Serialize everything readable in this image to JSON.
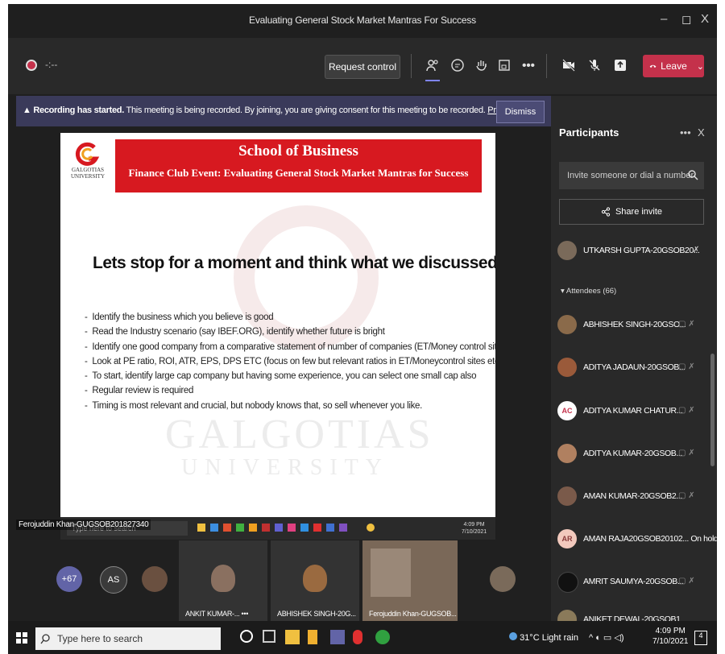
{
  "window": {
    "title": "Evaluating General Stock Market Mantras For Success",
    "minimize": "–",
    "maximize": "◻",
    "close": "X"
  },
  "toolbar": {
    "timer": "-:--",
    "request_control": "Request control",
    "more": "•••",
    "leave": "Leave",
    "leave_chevron": "⌄"
  },
  "banner": {
    "bold": "Recording has started.",
    "text": " This meeting is being recorded. By joining, you are giving consent for this meeting to be recorded. ",
    "link": "Privacy policy",
    "dismiss": "Dismiss"
  },
  "slide": {
    "school": "School of Business",
    "event": "Finance Club Event: Evaluating General Stock Market Mantras for Success",
    "logo_text": "GALGOTIAS UNIVERSITY",
    "heading": "Lets stop for a moment and think what we discussed till now……",
    "bullets": [
      "Identify the business which you believe is good",
      "Read the Industry scenario (say IBEF.ORG), identify whether future is bright",
      "Identify one good company from a comparative statement of number of companies (ET/Money control sites etc )",
      "Look at PE ratio, ROI, ATR, EPS, DPS ETC (focus on few but relevant ratios in ET/Moneycontrol sites etc)",
      "To start, identify large cap company but having some experience, you can select one small cap also",
      "Regular review is required",
      "Timing is most relevant and crucial, but nobody knows that, so sell whenever you like."
    ],
    "watermark1": "GALGOTIAS",
    "watermark2": "UNIVERSITY"
  },
  "presenter": {
    "name": "Ferojuddin Khan-GUGSOB201827340",
    "inner_search": "Type here to search",
    "inner_time": "4:09 PM",
    "inner_date": "7/10/2021"
  },
  "panel": {
    "title": "Participants",
    "more": "•••",
    "close": "X",
    "invite_placeholder": "Invite someone or dial a number",
    "share_invite": "Share invite",
    "presenter_row": "UTKARSH GUPTA-20GSOB20...",
    "attendees_label": "Attendees (66)",
    "attendees": [
      {
        "name": "ABHISHEK SINGH-20GSO...",
        "initials": "",
        "color": "#8a6a4a",
        "status": ""
      },
      {
        "name": "ADITYA JADAUN-20GSOB...",
        "initials": "",
        "color": "#9a5a3a",
        "status": ""
      },
      {
        "name": "ADITYA KUMAR CHATUR...",
        "initials": "AC",
        "color": "#ffffff",
        "status": ""
      },
      {
        "name": "ADITYA KUMAR-20GSOB...",
        "initials": "",
        "color": "#b08060",
        "status": ""
      },
      {
        "name": "AMAN KUMAR-20GSOB2...",
        "initials": "",
        "color": "#7a5a4a",
        "status": ""
      },
      {
        "name": "AMAN RAJA20GSOB20102... On hold",
        "initials": "AR",
        "color": "#f2c9bd",
        "status": ""
      },
      {
        "name": "AMRIT SAUMYA-20GSOB...",
        "initials": "",
        "color": "#111111",
        "status": ""
      },
      {
        "name": "ANIKET DEWAI -20GSOB1",
        "initials": "",
        "color": "#8a7a5a",
        "status": ""
      }
    ]
  },
  "strip": {
    "more_count": "+67",
    "as_initials": "AS",
    "tiles": [
      {
        "name": "ANKIT KUMAR-...",
        "more": "•••"
      },
      {
        "name": "ABHISHEK SINGH-20G..."
      },
      {
        "name": "Ferojuddin Khan-GUGSOB..."
      }
    ]
  },
  "taskbar": {
    "search_placeholder": "Type here to search",
    "weather": "31°C  Light rain",
    "time": "4:09 PM",
    "date": "7/10/2021",
    "notif": "4"
  },
  "colors": {
    "leave": "#c4314b",
    "banner": "#3a3a5a",
    "slide_red": "#d71920"
  }
}
